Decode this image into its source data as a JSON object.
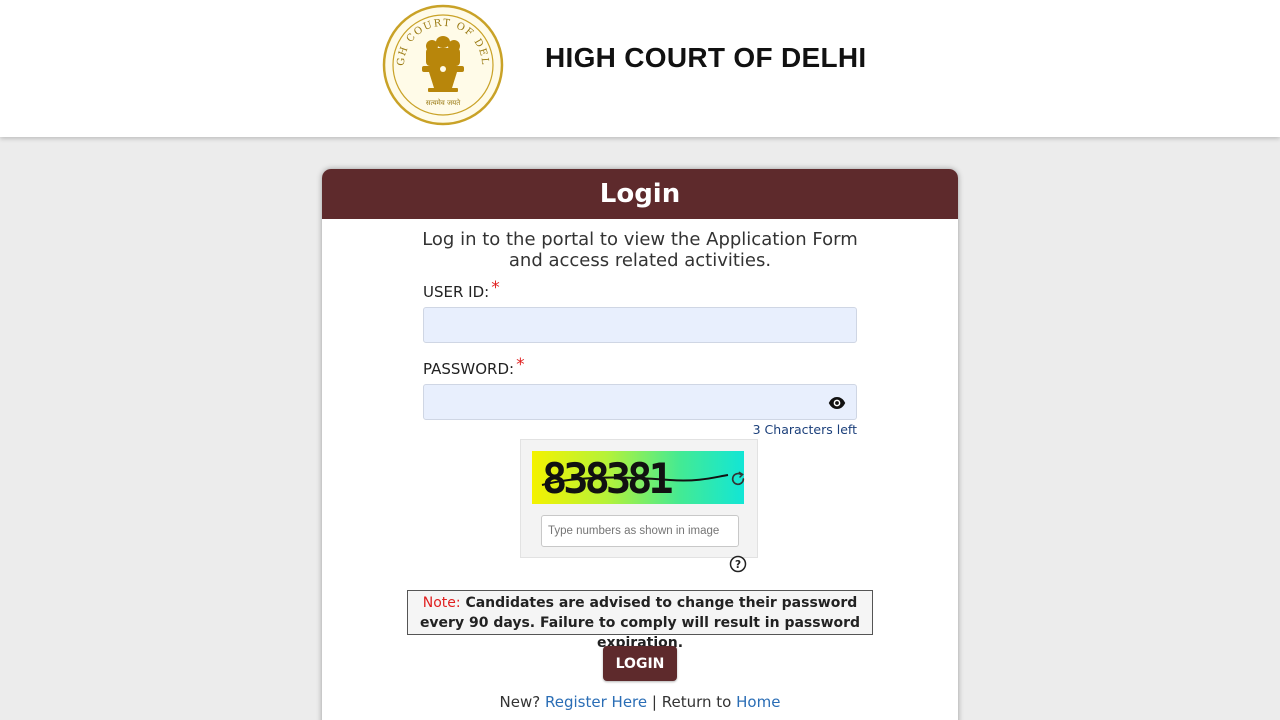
{
  "header": {
    "title": "HIGH COURT OF DELHI",
    "emblem_text_top": "HIGH COURT OF DELHI",
    "emblem_text_bottom": "सत्यमेव जयते"
  },
  "login": {
    "heading": "Login",
    "intro_line1": "Log in to the portal to view the Application Form",
    "intro_line2": "and access related activities.",
    "user_id_label": "USER ID:",
    "user_id_value": "",
    "password_label": "PASSWORD:",
    "password_value": "",
    "required_mark": "*",
    "chars_left": "3 Characters left",
    "captcha_code": "838381",
    "captcha_placeholder": "Type numbers as shown in image",
    "note_label": "Note:",
    "note_text": "Candidates are advised to change their password every 90 days. Failure to comply will result in password expiration.",
    "login_button": "LOGIN",
    "new_text": "New?",
    "register_link": "Register Here",
    "separator": "|",
    "return_text": "Return to",
    "home_link": "Home"
  },
  "icons": {
    "emblem": "court-emblem-icon",
    "eye": "eye-icon",
    "refresh": "refresh-icon",
    "help": "help-icon"
  },
  "colors": {
    "brand": "#5e2a2c",
    "required": "#e02020",
    "link": "#2a6db5",
    "input_bg": "#e8effd"
  }
}
